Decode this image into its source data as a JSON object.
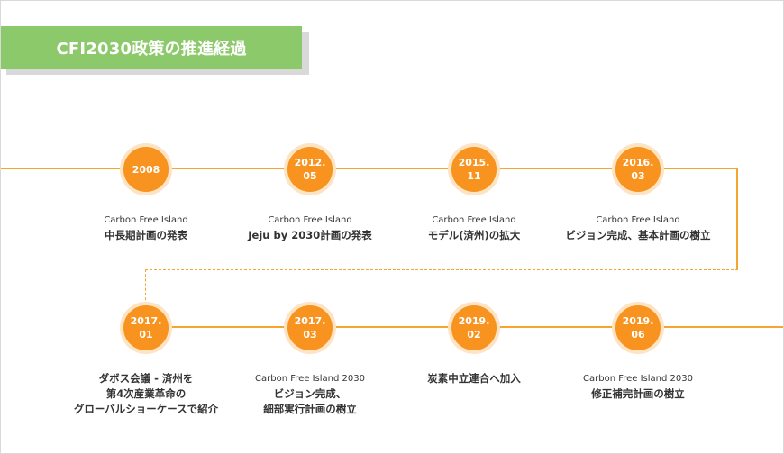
{
  "title": "CFI2030政策の推進経過",
  "colors": {
    "banner": "#8cc96b",
    "accent": "#f7931e",
    "line": "#f5a530"
  },
  "milestones": [
    {
      "date": [
        "2008"
      ],
      "sub": "Carbon Free Island",
      "main": [
        "中長期計画の発表"
      ]
    },
    {
      "date": [
        "2012.",
        "05"
      ],
      "sub": "Carbon Free Island",
      "main": [
        "Jeju by 2030計画の発表"
      ]
    },
    {
      "date": [
        "2015.",
        "11"
      ],
      "sub": "Carbon Free Island",
      "main": [
        "モデル(済州)の拡大"
      ]
    },
    {
      "date": [
        "2016.",
        "03"
      ],
      "sub": "Carbon Free Island",
      "main": [
        "ビジョン完成、基本計画の樹立"
      ]
    },
    {
      "date": [
        "2017.",
        "01"
      ],
      "sub": "",
      "main": [
        "ダボス会議 - 済州を",
        "第4次産業革命の",
        "グローバルショーケースで紹介"
      ]
    },
    {
      "date": [
        "2017.",
        "03"
      ],
      "sub": "Carbon Free Island 2030",
      "main": [
        "ビジョン完成、",
        "細部実行計画の樹立"
      ]
    },
    {
      "date": [
        "2019.",
        "02"
      ],
      "sub": "",
      "main": [
        "炭素中立連合へ加入"
      ]
    },
    {
      "date": [
        "2019.",
        "06"
      ],
      "sub": "Carbon Free Island 2030",
      "main": [
        "修正補完計画の樹立"
      ]
    }
  ]
}
